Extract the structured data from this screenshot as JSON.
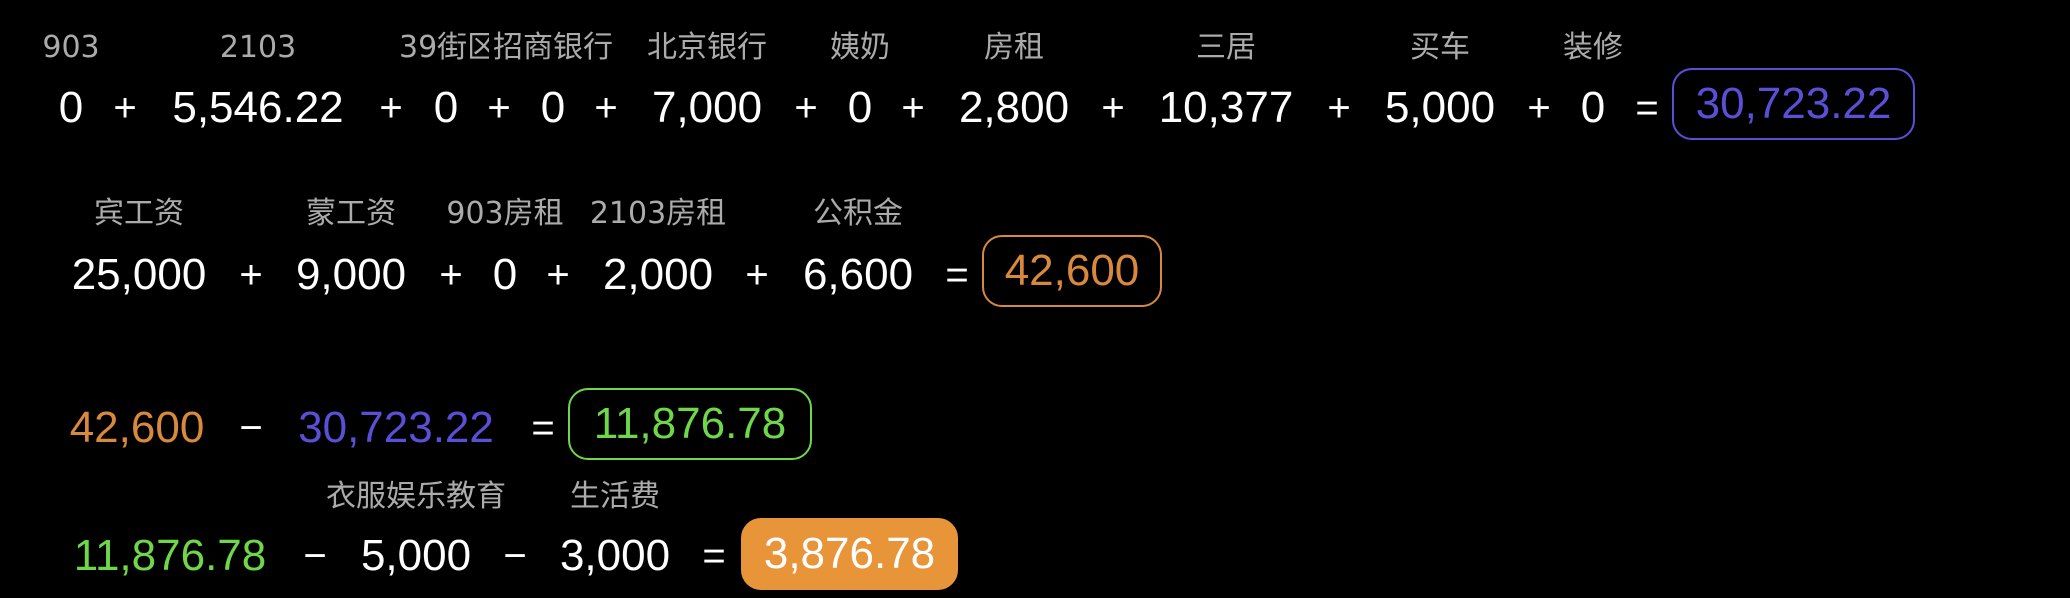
{
  "colors": {
    "background": "#000000",
    "label": "#ababab",
    "purple": "#5a4fd6",
    "orange": "#d8893d",
    "green": "#6fd84a",
    "orange_fill": "#e8953a"
  },
  "expenses": {
    "labels": [
      "903",
      "2103",
      "39街区",
      "招商银行",
      "北京银行",
      "姨奶",
      "房租",
      "三居",
      "买车",
      "装修"
    ],
    "values": [
      "0",
      "5,546.22",
      "0",
      "0",
      "7,000",
      "0",
      "2,800",
      "10,377",
      "5,000",
      "0"
    ],
    "plus": "+",
    "equals": "=",
    "total": "30,723.22"
  },
  "income": {
    "labels": [
      "宾工资",
      "蒙工资",
      "903房租",
      "2103房租",
      "公积金"
    ],
    "values": [
      "25,000",
      "9,000",
      "0",
      "2,000",
      "6,600"
    ],
    "plus": "+",
    "equals": "=",
    "total": "42,600"
  },
  "balance": {
    "a": "42,600",
    "minus": "−",
    "b": "30,723.22",
    "equals": "=",
    "result": "11,876.78"
  },
  "final": {
    "labels": [
      "衣服娱乐教育",
      "生活费"
    ],
    "start": "11,876.78",
    "minus": "−",
    "values": [
      "5,000",
      "3,000"
    ],
    "equals": "=",
    "result": "3,876.78"
  }
}
